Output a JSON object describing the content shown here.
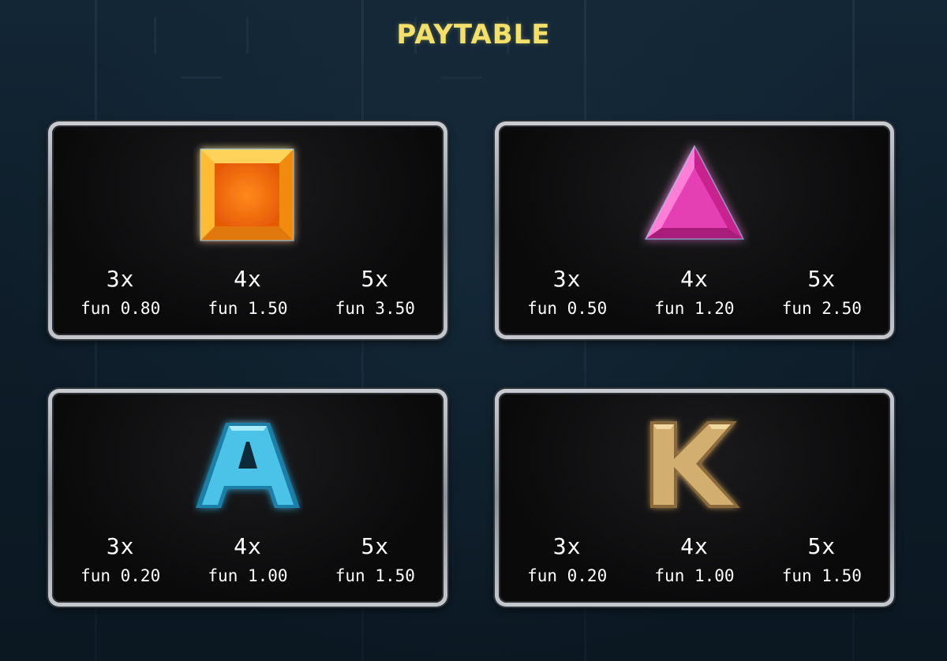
{
  "paytable": {
    "title": "PAYTABLE",
    "cards": [
      {
        "symbol": "orange-square-gem-icon",
        "pays": [
          {
            "count": "3x",
            "value": "fun 0.80"
          },
          {
            "count": "4x",
            "value": "fun 1.50"
          },
          {
            "count": "5x",
            "value": "fun 3.50"
          }
        ]
      },
      {
        "symbol": "pink-triangle-gem-icon",
        "pays": [
          {
            "count": "3x",
            "value": "fun 0.50"
          },
          {
            "count": "4x",
            "value": "fun 1.20"
          },
          {
            "count": "5x",
            "value": "fun 2.50"
          }
        ]
      },
      {
        "symbol": "blue-letter-a-icon",
        "symbol_text": "A",
        "pays": [
          {
            "count": "3x",
            "value": "fun 0.20"
          },
          {
            "count": "4x",
            "value": "fun 1.00"
          },
          {
            "count": "5x",
            "value": "fun 1.50"
          }
        ]
      },
      {
        "symbol": "gold-letter-k-icon",
        "symbol_text": "K",
        "pays": [
          {
            "count": "3x",
            "value": "fun 0.20"
          },
          {
            "count": "4x",
            "value": "fun 1.00"
          },
          {
            "count": "5x",
            "value": "fun 1.50"
          }
        ]
      }
    ]
  },
  "colors": {
    "title": "#f2e06a",
    "orange_gem": "#f39a12",
    "pink_gem": "#e03cb0",
    "blue_letter": "#3fb8de",
    "gold_letter": "#c9a263"
  }
}
